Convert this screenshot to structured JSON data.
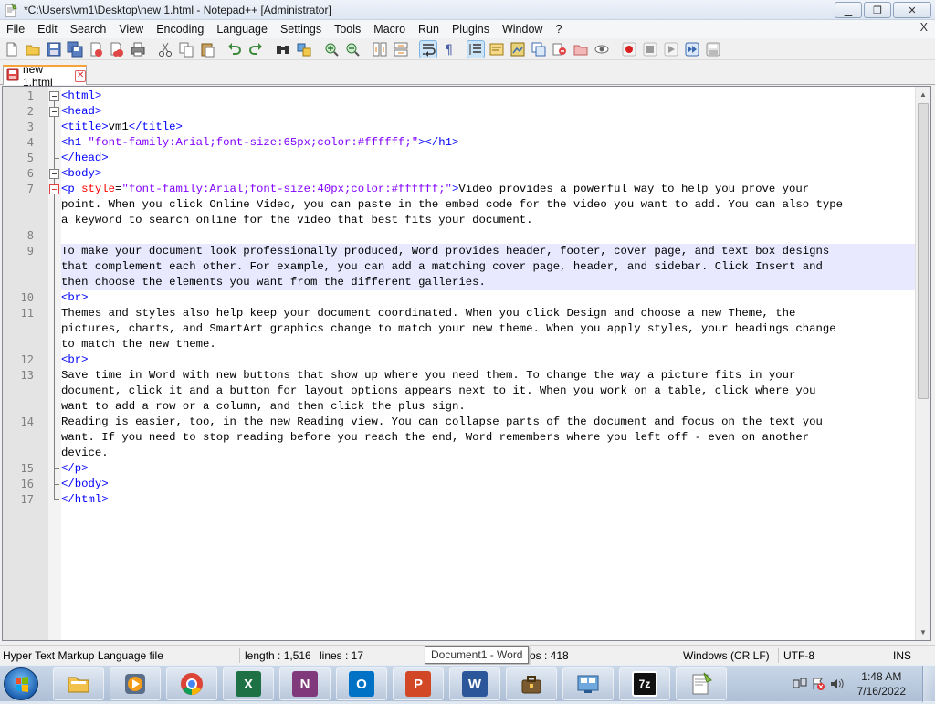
{
  "window": {
    "title": "*C:\\Users\\vm1\\Desktop\\new 1.html - Notepad++ [Administrator]",
    "controls": {
      "minimize": "▁",
      "maximize": "❐",
      "close": "✕"
    }
  },
  "menubar": {
    "items": [
      "File",
      "Edit",
      "Search",
      "View",
      "Encoding",
      "Language",
      "Settings",
      "Tools",
      "Macro",
      "Run",
      "Plugins",
      "Window",
      "?"
    ],
    "close_doc": "X"
  },
  "tabs": [
    {
      "label": "new 1.html",
      "active": true,
      "close": "✕"
    }
  ],
  "editor": {
    "lines": [
      {
        "n": "1",
        "segments": [
          [
            "tag",
            "<html>"
          ]
        ]
      },
      {
        "n": "2",
        "segments": [
          [
            "tag",
            "<head>"
          ]
        ]
      },
      {
        "n": "3",
        "segments": [
          [
            "tag",
            "<title>"
          ],
          [
            "txt",
            "vm1"
          ],
          [
            "tag",
            "</title>"
          ]
        ]
      },
      {
        "n": "4",
        "segments": [
          [
            "tag",
            "<h1 "
          ],
          [
            "str",
            "\"font-family:Arial;font-size:65px;color:#ffffff;\""
          ],
          [
            "tag",
            "></h1>"
          ]
        ]
      },
      {
        "n": "5",
        "segments": [
          [
            "tag",
            "</head>"
          ]
        ]
      },
      {
        "n": "6",
        "segments": [
          [
            "tag",
            "<body>"
          ]
        ]
      },
      {
        "n": "7",
        "segments": [
          [
            "tag",
            "<p "
          ],
          [
            "attr",
            "style"
          ],
          [
            "txt",
            "="
          ],
          [
            "str",
            "\"font-family:Arial;font-size:40px;color:#ffffff;\""
          ],
          [
            "tag",
            ">"
          ],
          [
            "txt",
            "Video provides a powerful way to help you prove your"
          ]
        ]
      },
      {
        "n": "",
        "segments": [
          [
            "txt",
            "point. When you click Online Video, you can paste in the embed code for the video you want to add. You can also type"
          ]
        ]
      },
      {
        "n": "",
        "segments": [
          [
            "txt",
            "a keyword to search online for the video that best fits your document."
          ]
        ]
      },
      {
        "n": "8",
        "segments": []
      },
      {
        "n": "9",
        "segments": [
          [
            "txt",
            "To make your document look professionally produced, Word provides header, footer, cover page, and text box designs"
          ]
        ]
      },
      {
        "n": "",
        "segments": [
          [
            "txt",
            "that complement each other. For example, you can add a matching cover page, header, and sidebar. Click Insert and"
          ]
        ]
      },
      {
        "n": "",
        "segments": [
          [
            "txt",
            "then choose the elements you want from the different galleries."
          ]
        ]
      },
      {
        "n": "10",
        "segments": [
          [
            "tag",
            "<br>"
          ]
        ]
      },
      {
        "n": "11",
        "segments": [
          [
            "txt",
            "Themes and styles also help keep your document coordinated. When you click Design and choose a new Theme, the"
          ]
        ]
      },
      {
        "n": "",
        "segments": [
          [
            "txt",
            "pictures, charts, and SmartArt graphics change to match your new theme. When you apply styles, your headings change"
          ]
        ]
      },
      {
        "n": "",
        "segments": [
          [
            "txt",
            "to match the new theme."
          ]
        ]
      },
      {
        "n": "12",
        "segments": [
          [
            "tag",
            "<br>"
          ]
        ]
      },
      {
        "n": "13",
        "segments": [
          [
            "txt",
            "Save time in Word with new buttons that show up where you need them. To change the way a picture fits in your"
          ]
        ]
      },
      {
        "n": "",
        "segments": [
          [
            "txt",
            "document, click it and a button for layout options appears next to it. When you work on a table, click where you"
          ]
        ]
      },
      {
        "n": "",
        "segments": [
          [
            "txt",
            "want to add a row or a column, and then click the plus sign."
          ]
        ]
      },
      {
        "n": "14",
        "segments": [
          [
            "txt",
            "Reading is easier, too, in the new Reading view. You can collapse parts of the document and focus on the text you"
          ]
        ]
      },
      {
        "n": "",
        "segments": [
          [
            "txt",
            "want. If you need to stop reading before you reach the end, Word remembers where you left off - even on another"
          ]
        ]
      },
      {
        "n": "",
        "segments": [
          [
            "txt",
            "device."
          ]
        ]
      },
      {
        "n": "15",
        "segments": [
          [
            "tag",
            "</p>"
          ]
        ]
      },
      {
        "n": "16",
        "segments": [
          [
            "tag",
            "</body>"
          ]
        ]
      },
      {
        "n": "17",
        "segments": [
          [
            "tag",
            "</html>"
          ]
        ]
      }
    ],
    "highlighted_line": "9",
    "colors": {
      "tag": "#0000ff",
      "attr": "#ff0000",
      "string": "#8000ff",
      "highlight": "#e8e8ff"
    }
  },
  "statusbar": {
    "file_type": "Hyper Text Markup Language file",
    "length": "length : 1,516",
    "lines": "lines : 17",
    "pos": "os : 418",
    "eol": "Windows (CR LF)",
    "encoding": "UTF-8",
    "mode": "INS"
  },
  "tooltip": {
    "text": "Document1 - Word"
  },
  "taskbar": {
    "apps": [
      {
        "name": "file-explorer",
        "icon": "folder-icon"
      },
      {
        "name": "media-player",
        "icon": "play-icon"
      },
      {
        "name": "chrome",
        "icon": "chrome-icon"
      },
      {
        "name": "excel",
        "icon": "excel-icon",
        "letter": "X",
        "color": "#1e7145"
      },
      {
        "name": "onenote",
        "icon": "onenote-icon",
        "letter": "N",
        "color": "#80397b"
      },
      {
        "name": "outlook",
        "icon": "outlook-icon",
        "letter": "O",
        "color": "#0072c6"
      },
      {
        "name": "powerpoint",
        "icon": "powerpoint-icon",
        "letter": "P",
        "color": "#d24726"
      },
      {
        "name": "word",
        "icon": "word-icon",
        "letter": "W",
        "color": "#2b579a"
      },
      {
        "name": "network-app",
        "icon": "briefcase-icon"
      },
      {
        "name": "control-panel",
        "icon": "control-panel-icon"
      },
      {
        "name": "7zip",
        "icon": "7zip-icon",
        "letter": "7z"
      },
      {
        "name": "notepadpp",
        "icon": "notepadpp-icon"
      }
    ],
    "clock": {
      "time": "1:48 AM",
      "date": "7/16/2022"
    }
  }
}
